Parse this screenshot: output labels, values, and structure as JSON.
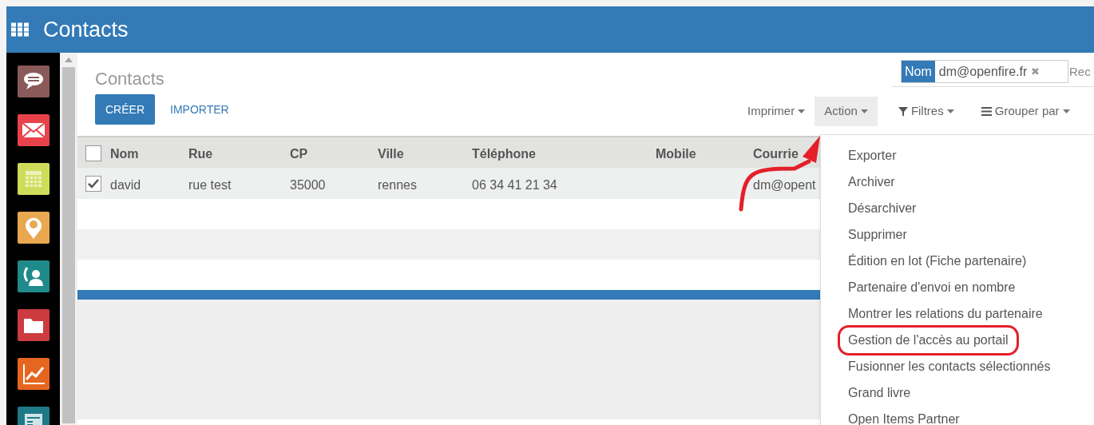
{
  "app_bar": {
    "title": "Contacts"
  },
  "sidebar": {
    "apps": [
      {
        "kind": "chat"
      },
      {
        "kind": "mail"
      },
      {
        "kind": "calendar"
      },
      {
        "kind": "pin"
      },
      {
        "kind": "phone"
      },
      {
        "kind": "folder"
      },
      {
        "kind": "chart"
      },
      {
        "kind": "news"
      }
    ]
  },
  "breadcrumb": "Contacts",
  "buttons": {
    "create": "CRÉER",
    "import": "IMPORTER"
  },
  "search": {
    "facet": "Nom",
    "value": "dm@openfire.fr",
    "remove": "✖",
    "placeholder": "Rec"
  },
  "toolbar": [
    {
      "label": "Imprimer",
      "open": false
    },
    {
      "label": "Action",
      "open": true
    },
    {
      "label": "Filtres",
      "open": false
    },
    {
      "label": "Grouper par",
      "open": false
    }
  ],
  "table": {
    "header_checked": false,
    "columns": [
      "Nom",
      "Rue",
      "CP",
      "Ville",
      "Téléphone",
      "Mobile",
      "Courrie"
    ],
    "rows": [
      {
        "checked": true,
        "cells": [
          "david",
          "rue test",
          "35000",
          "rennes",
          "06 34 41 21 34",
          "",
          "dm@opent"
        ]
      }
    ]
  },
  "action_menu": {
    "items": [
      {
        "label": "Exporter",
        "highlighted": false
      },
      {
        "label": "Archiver",
        "highlighted": false
      },
      {
        "label": "Désarchiver",
        "highlighted": false
      },
      {
        "label": "Supprimer",
        "highlighted": false
      },
      {
        "label": "Édition en lot (Fiche partenaire)",
        "highlighted": false
      },
      {
        "label": "Partenaire d'envoi en nombre",
        "highlighted": false
      },
      {
        "label": "Montrer les relations du partenaire",
        "highlighted": false
      },
      {
        "label": "Gestion de l'accès au portail",
        "highlighted": true
      },
      {
        "label": "Fusionner les contacts sélectionnés",
        "highlighted": false
      },
      {
        "label": "Grand livre",
        "highlighted": false
      },
      {
        "label": "Open Items Partner",
        "highlighted": false
      }
    ]
  }
}
